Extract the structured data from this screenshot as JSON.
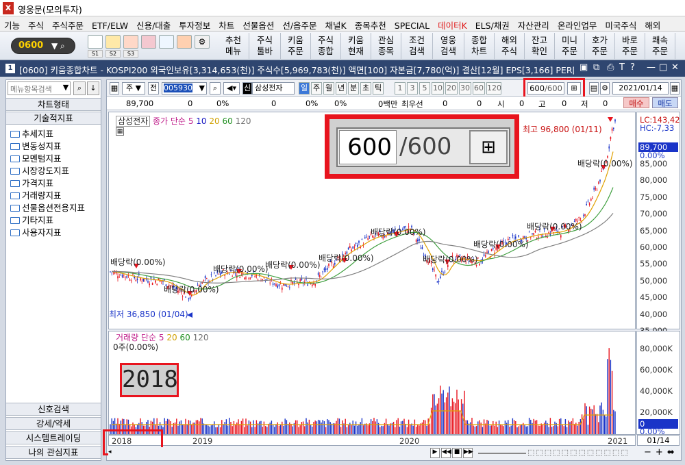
{
  "app": {
    "title": "영웅문(모의투자)"
  },
  "menu": [
    "기능",
    "주식",
    "주식주문",
    "ETF/ELW",
    "신용/대출",
    "투자정보",
    "차트",
    "선물옵션",
    "선/옵주문",
    "채널K",
    "종목추천",
    "SPECIAL",
    "데이터K",
    "ELS/채권",
    "자산관리",
    "온라인업무",
    "미국주식",
    "해외"
  ],
  "menu_highlight_index": 12,
  "toolbar": {
    "screen_code": "0600",
    "slots": [
      "S1",
      "S2",
      "S3"
    ],
    "buttons": [
      "추천\n메뉴",
      "주식\n툴바",
      "키움\n주문",
      "주식\n종합",
      "키움\n현재",
      "관심\n종목",
      "조건\n검색",
      "영웅\n검색",
      "종합\n차트",
      "해외\n주식",
      "잔고\n확인",
      "미니\n주문",
      "호가\n주문",
      "바로\n주문",
      "쾌속\n주문"
    ]
  },
  "window": {
    "number": "1",
    "title": "[0600] 키움종합차트 - KOSPI200 외국인보유[3,314,653(천)] 주식수[5,969,783(천)] 액면[100] 자본금[7,780(억)] 결산[12월] EPS[3,166] PER[28"
  },
  "left": {
    "search_placeholder": "메뉴항목검색",
    "header_top": "차트형태",
    "header_tech": "기술적지표",
    "folders": [
      "추세지표",
      "변동성지표",
      "모멘텀지표",
      "시장강도지표",
      "가격지표",
      "거래량지표",
      "선물옵션전용지표",
      "기타지표",
      "사용자지표"
    ],
    "bottom": [
      "신호검색",
      "강세/약세",
      "시스템트레이딩",
      "나의 관심지표"
    ]
  },
  "chart_toolbar": {
    "type_label": "주",
    "prefix": "전",
    "stock_code": "005930",
    "credit": "신",
    "stock_name": "삼성전자",
    "periods": [
      "일",
      "주",
      "월",
      "년",
      "분",
      "초",
      "틱"
    ],
    "numbers": [
      "1",
      "3",
      "5",
      "10",
      "20",
      "30",
      "60",
      "120"
    ],
    "count_display": "600",
    "count_total": "/600",
    "date": "2021/01/14"
  },
  "quote": {
    "price": "89,700",
    "v1": "0",
    "v2": "0%",
    "v3": "0",
    "v4": "0%",
    "v5": "0%",
    "v6": "0백만",
    "best": "최우선",
    "v7": "0",
    "v8": "0",
    "open_label": "시",
    "open": "0",
    "high_label": "고",
    "high": "0",
    "low_label": "저",
    "low": "0",
    "buy": "매수",
    "sell": "매도"
  },
  "price_legend": {
    "name": "삼성전자",
    "series": "종가 단순",
    "ma": [
      "5",
      "10",
      "20",
      "60",
      "120"
    ]
  },
  "volume_legend": {
    "name": "거래량",
    "series": "단순",
    "ma": [
      "5",
      "20",
      "60",
      "120"
    ],
    "value": "0주(0.00%)"
  },
  "annotations": {
    "high": "최고 96,800 (01/11)",
    "low": "최저 36,850 (01/04)",
    "dividends": [
      "배당락(0.00%)",
      "배당락(0.00%)",
      "배당락(0.00%)",
      "배당락(0.00%)",
      "배당락(0.00%)",
      "배당락(0.00%)",
      "배당락(0.00%)",
      "배당락(0.00%)",
      "배당락(0.00%)",
      "배당락(0.00%)",
      "배당락(0.00%)"
    ]
  },
  "price_axis": {
    "lc": "LC:143,42",
    "hc": "HC:-7,33",
    "current": "89,700",
    "current_pct": "0.00%",
    "ticks": [
      "85,000",
      "80,000",
      "75,000",
      "70,000",
      "65,000",
      "60,000",
      "55,000",
      "50,000",
      "45,000",
      "40,000",
      "35,000"
    ]
  },
  "volume_axis": {
    "ticks": [
      "80,000K",
      "60,000K",
      "40,000K",
      "20,000K"
    ],
    "current": "0",
    "current_pct": "0.00%"
  },
  "x_axis": {
    "labels": [
      "2018",
      "2019",
      "2020",
      "2021"
    ],
    "date": "01/14"
  },
  "callout": {
    "big_count": "600",
    "big_total": "/600",
    "year_big": "2018"
  },
  "colors": {
    "accent_red": "#e8141e",
    "winbar": "#2f4670",
    "ma5": "#e0a000",
    "ma20": "#40a040",
    "ma120": "#808080"
  }
}
